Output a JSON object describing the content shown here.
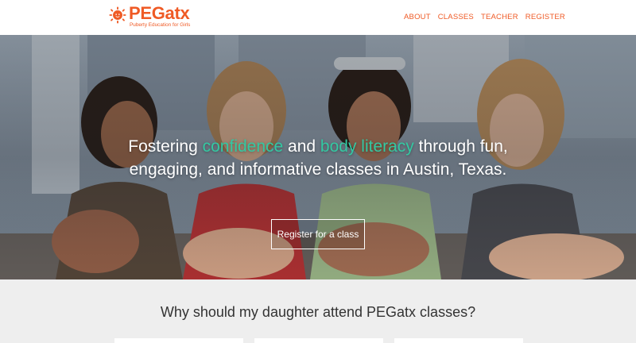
{
  "brand": {
    "name": "PEGatx",
    "tagline": "Puberty Education for Girls",
    "accent_color": "#ef5a25"
  },
  "nav": {
    "items": [
      {
        "label": "ABOUT"
      },
      {
        "label": "CLASSES"
      },
      {
        "label": "TEACHER"
      },
      {
        "label": "REGISTER"
      }
    ]
  },
  "hero": {
    "line1_a": "Fostering ",
    "line1_hl1": "confidence",
    "line1_b": " and ",
    "line1_hl2": "body literacy",
    "line1_c": " through fun,",
    "line2": "engaging, and informative classes in Austin, Texas.",
    "highlight_color": "#34c8a2",
    "cta_label": "Register for a class"
  },
  "section": {
    "title": "Why should my daughter attend PEGatx classes?"
  }
}
